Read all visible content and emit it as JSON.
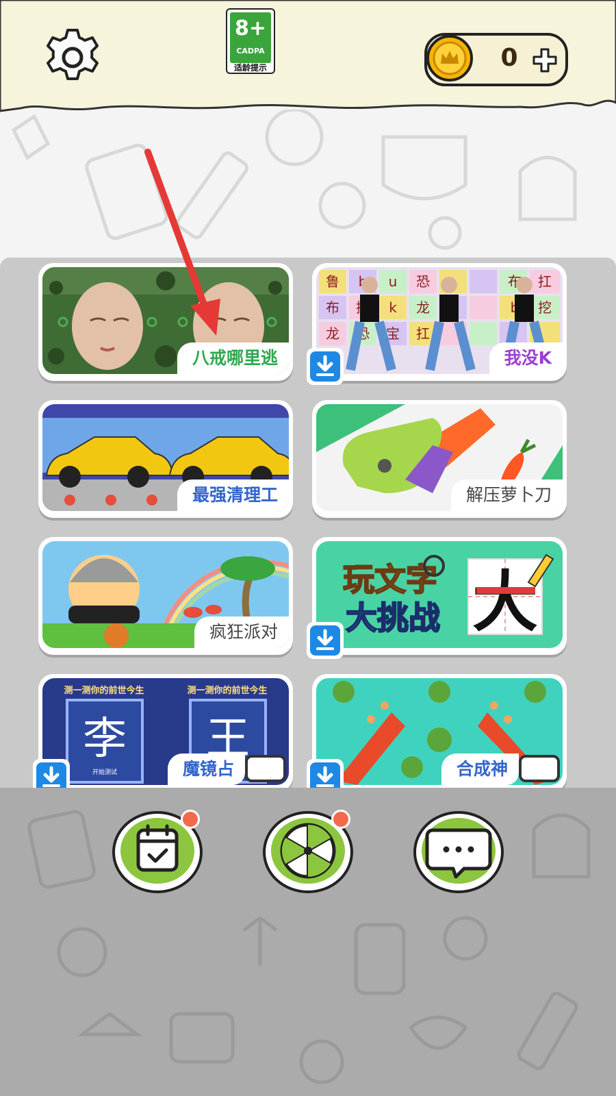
{
  "topbar": {
    "age_rating": {
      "number": "8+",
      "org": "CADPA",
      "tip": "适龄提示"
    },
    "coins": {
      "value": "0"
    }
  },
  "games": [
    {
      "label": "八戒哪里逃",
      "label_color": "#2fa84f",
      "download": false,
      "video": false
    },
    {
      "label": "我没K",
      "label_color": "#9b3fd0",
      "download": true,
      "video": false
    },
    {
      "label": "最强清理工",
      "label_color": "#3366cc",
      "download": false,
      "video": false
    },
    {
      "label": "解压萝卜刀",
      "label_color": "#444444",
      "download": false,
      "video": false
    },
    {
      "label": "疯狂派对",
      "label_color": "#444444",
      "download": false,
      "video": false
    },
    {
      "label": "",
      "label_color": "#444444",
      "download": true,
      "video": false
    },
    {
      "label": "魔镜占",
      "label_color": "#3366cc",
      "download": true,
      "video": true
    },
    {
      "label": "合成神",
      "label_color": "#3366cc",
      "download": true,
      "video": true
    }
  ],
  "card_art_text": {
    "g2_letters": [
      "鲁",
      "b",
      "u",
      "恐",
      "布",
      "挖",
      "k",
      "龙",
      "龙",
      "恐",
      "宝",
      "扛",
      "布",
      "扛",
      "b",
      "挖"
    ],
    "g6_title1": "玩文字",
    "g6_title2": "大挑战",
    "g6_char": "大",
    "g7_banner": "测一测你的前世今生",
    "g7_char_left": "李",
    "g7_char_right": "王",
    "g7_sub": "开始测试"
  },
  "nav": {
    "items": [
      {
        "name": "calendar-checkin",
        "badge": true
      },
      {
        "name": "lucky-wheel",
        "badge": true
      },
      {
        "name": "messages",
        "badge": false
      }
    ]
  },
  "colors": {
    "topbar_bg": "#f7f4dc",
    "grid_bg": "#c9c9c9",
    "bottom_bg": "#ababab",
    "accent_green": "#8cc63f",
    "badge_red": "#f26a4b",
    "download_blue": "#1e88e5",
    "annotation_arrow": "#e53935"
  }
}
